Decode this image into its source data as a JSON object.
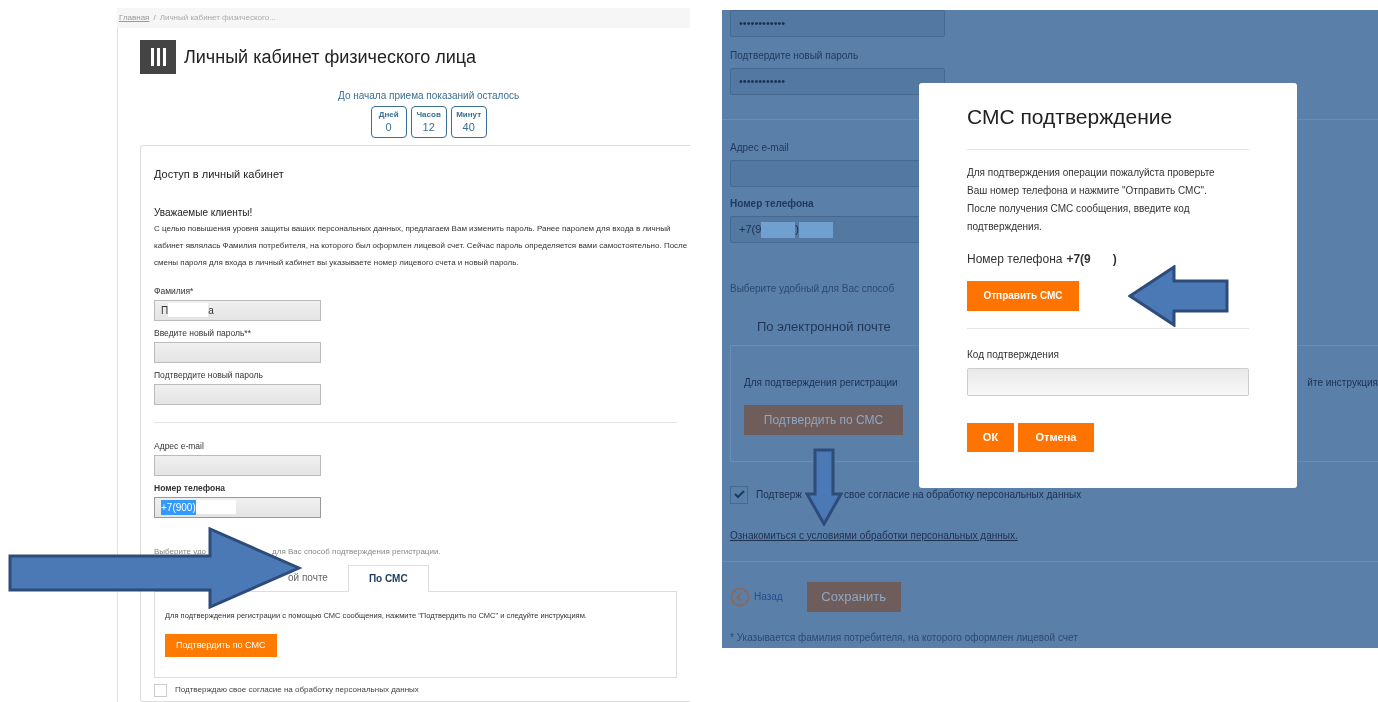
{
  "left_screenshot": {
    "breadcrumb": [
      {
        "kind": "link",
        "label": "Главная"
      },
      {
        "kind": "separator",
        "label": "/"
      },
      {
        "kind": "current",
        "label": "Личный кабинет физического..."
      }
    ],
    "title": "Личный кабинет физического лица",
    "countdown": {
      "caption": "До начала приема показаний осталось",
      "units": [
        {
          "label": "Дней",
          "value": "0"
        },
        {
          "label": "Часов",
          "value": "12"
        },
        {
          "label": "Минут",
          "value": "40"
        }
      ]
    },
    "card": {
      "heading": "Доступ в личный кабинет",
      "notice_title": "Уважаемые клиенты!",
      "notice_text": "С целью повышения уровня защиты ваших персональных данных, предлагаем Вам изменить пароль. Ранее паролем для входа в личный кабинет являлась Фамилия потребителя, на которого был оформлен лицевой счет. Сейчас пароль определяется вами самостоятельно. После смены пароля для входа в личный кабинет вы указываете номер лицевого счета и новый пароль.",
      "password_fields": [
        {
          "label": "Фамилия*",
          "bold_label": false,
          "selected": false,
          "value": [
            {
              "kind": "text",
              "text": "П"
            },
            {
              "kind": "redacted"
            },
            {
              "kind": "text",
              "text": "а"
            }
          ]
        },
        {
          "label": "Введите новый пароль**",
          "bold_label": false,
          "selected": false
        },
        {
          "label": "Подтвердите новый пароль",
          "bold_label": false,
          "selected": false
        }
      ],
      "contact_fields": [
        {
          "label": "Адрес e-mail",
          "bold_label": false,
          "selected": false
        },
        {
          "label": "Номер телефона",
          "bold_label": true,
          "selected": true,
          "value": [
            {
              "kind": "text",
              "text": "+7(900)"
            },
            {
              "kind": "redacted"
            }
          ]
        }
      ],
      "method_hint_parts": [
        "Выберите удо",
        "для Вас способ подтверждения регистрации."
      ],
      "tabs": [
        {
          "label": "ой почте",
          "selected": false
        },
        {
          "label": "По СМС",
          "selected": true
        }
      ],
      "sms_hint": "Для подтверждения регистрации с помощью СМС сообщения, нажмите \"Подтвердить по СМС\" и следуйте инструкциям.",
      "confirm_button": "Подтвердить по СМС",
      "consent": {
        "label": "Подтверждаю свое согласие на обработку персональных данных",
        "checked": false
      }
    }
  },
  "right_screenshot": {
    "fields": [
      {
        "selected": false,
        "value": [
          {
            "kind": "text",
            "text": "••••••••••••"
          }
        ]
      },
      {
        "label": "Подтвердите новый пароль",
        "bold_label": false,
        "selected": false,
        "value": [
          {
            "kind": "text",
            "text": "••••••••••••"
          }
        ]
      },
      {
        "label": "Адрес e-mail",
        "bold_label": false,
        "selected": false
      },
      {
        "label": "Номер телефона",
        "bold_label": true,
        "selected": false,
        "value": [
          {
            "kind": "text",
            "text": "+7(9"
          },
          {
            "kind": "redacted"
          },
          {
            "kind": "text",
            "text": ")"
          },
          {
            "kind": "redacted"
          }
        ]
      }
    ],
    "method_hint": "Выберите удобный для Вас способ",
    "tab": "По электронной почте",
    "hint_left": "Для подтверждения регистрации",
    "hint_right": "йте инструкция",
    "confirm_button": "Подтвердить по СМС",
    "consent": {
      "label_parts": [
        "Подтверж",
        "свое согласие на обработку персональных данных"
      ],
      "checked": true
    },
    "terms_link": "Ознакомиться с условиями обработки персональных данных.",
    "back_link": "Назад",
    "save_button": "Сохранить",
    "footnote": "* Указывается фамилия потребителя, на которого оформлен лицевой счет",
    "modal": {
      "title": "СМС подтверждение",
      "text": "Для подтверждения операции пожалуйста проверьте Ваш номер телефона и нажмите \"Отправить СМС\". После получения СМС сообщения, введите код подтверждения.",
      "phone_label": "Номер телефона",
      "phone_value": [
        {
          "kind": "text",
          "text": "+7(9"
        },
        {
          "kind": "redacted"
        },
        {
          "kind": "text",
          "text": ")"
        }
      ],
      "send_button": "Отправить СМС",
      "code_label": "Код подтверждения",
      "ok_button": "ОК",
      "cancel_button": "Отмена"
    }
  },
  "annotations": [
    {
      "kind": "right_arrow"
    },
    {
      "kind": "left_arrow"
    },
    {
      "kind": "down_arrow"
    }
  ]
}
